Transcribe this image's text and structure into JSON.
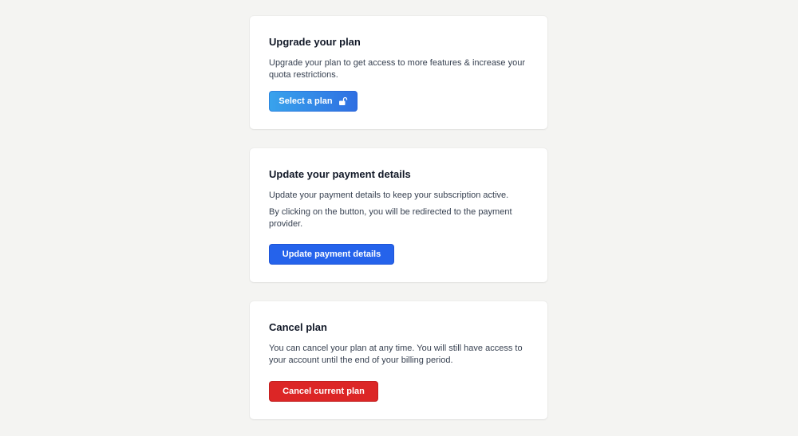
{
  "upgrade": {
    "title": "Upgrade your plan",
    "description": "Upgrade your plan to get access to more features & increase your quota restrictions.",
    "button_label": "Select a plan",
    "button_icon": "unlock-icon"
  },
  "payment": {
    "title": "Update your payment details",
    "description_1": "Update your payment details to keep your subscription active.",
    "description_2": "By clicking on the button, you will be redirected to the payment provider.",
    "button_label": "Update payment details"
  },
  "cancel": {
    "title": "Cancel plan",
    "description": "You can cancel your plan at any time. You will still have access to your account until the end of your billing period.",
    "button_label": "Cancel current plan"
  },
  "colors": {
    "background": "#f4f4f2",
    "primary": "#2563eb",
    "gradient_start": "#38a3ec",
    "danger": "#dc2626"
  }
}
